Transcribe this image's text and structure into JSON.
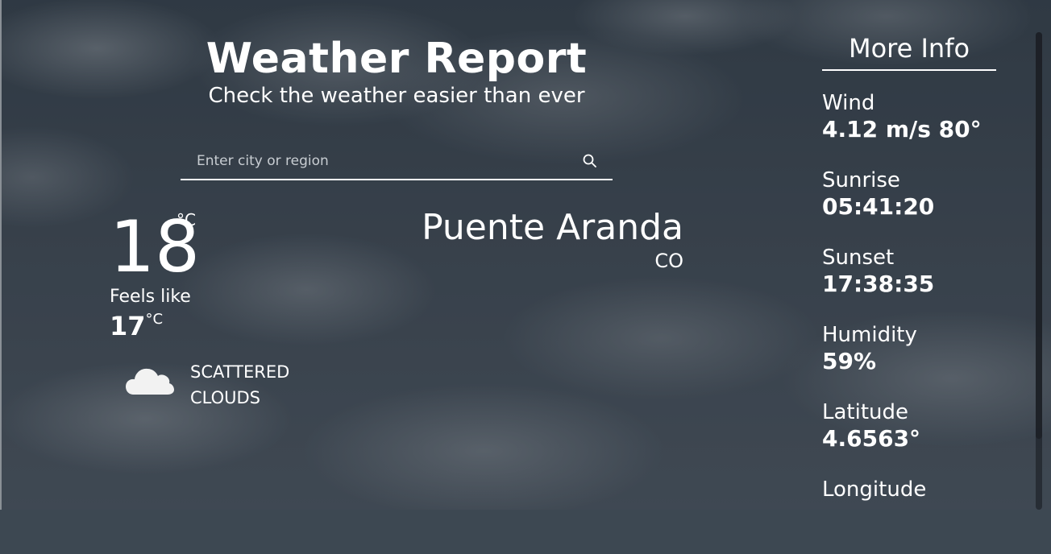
{
  "header": {
    "title": "Weather Report",
    "subtitle": "Check the weather easier than ever"
  },
  "search": {
    "placeholder": "Enter city or region",
    "value": "",
    "icon": "search-icon"
  },
  "current": {
    "temperature": "18",
    "temperature_unit": "°C",
    "feels_like_label": "Feels like",
    "feels_like_value": "17",
    "feels_like_unit": "°C",
    "condition": "SCATTERED CLOUDS",
    "condition_icon": "cloud-icon"
  },
  "location": {
    "city": "Puente Aranda",
    "country": "CO"
  },
  "more_info": {
    "title": "More Info",
    "items": [
      {
        "label": "Wind",
        "value": "4.12 m/s 80°"
      },
      {
        "label": "Sunrise",
        "value": "05:41:20"
      },
      {
        "label": "Sunset",
        "value": "17:38:35"
      },
      {
        "label": "Humidity",
        "value": "59%"
      },
      {
        "label": "Latitude",
        "value": "4.6563°"
      },
      {
        "label": "Longitude",
        "value": ""
      }
    ]
  },
  "colors": {
    "text": "#ffffff",
    "background_sky": "#3d4852",
    "placeholder": "#c8cdd2"
  }
}
